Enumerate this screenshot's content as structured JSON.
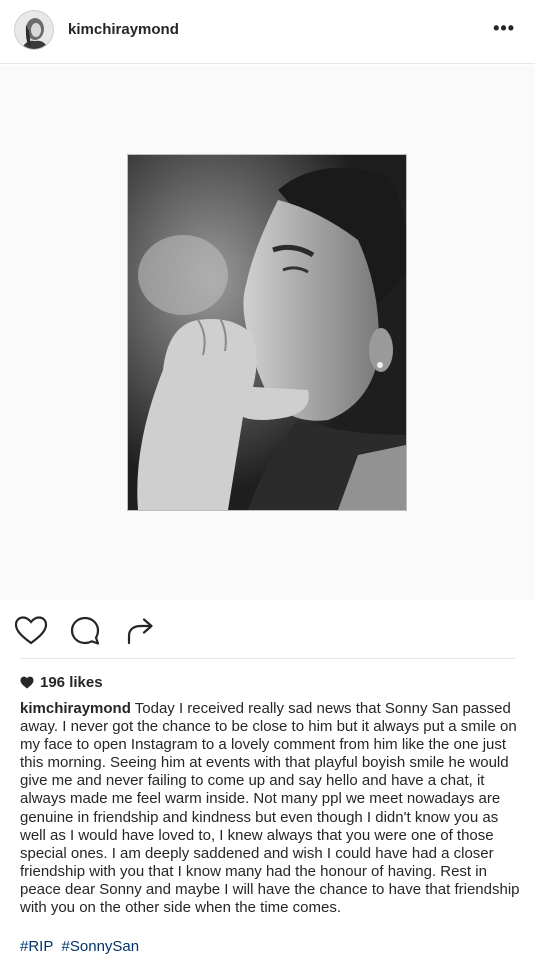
{
  "header": {
    "username": "kimchiraymond",
    "more_label": "•••"
  },
  "post": {
    "image_alt": "Black and white photo of a man with his hand near his chin",
    "likes": "196 likes",
    "caption_user": "kimchiraymond",
    "caption_text": "Today I received really sad news that Sonny San passed away. I never got the chance to be close to him but it always put a smile on my face to open Instagram to a lovely comment from him like the one just this morning. Seeing him at events with that playful boyish smile he would give me and never failing to come up and say hello and have a chat, it always made me feel warm inside. Not many ppl we meet nowadays are genuine in friendship and kindness but even though I didn't know you as well as I would have loved to, I knew always that you were one of those special ones. I am deeply saddened and wish I could have had a closer friendship with you that I know many had the honour of having. Rest in peace dear Sonny and maybe I will have the chance to have that friendship with you on the other side when the time comes.",
    "hashtags": [
      "#RIP",
      "#SonnySan"
    ]
  }
}
